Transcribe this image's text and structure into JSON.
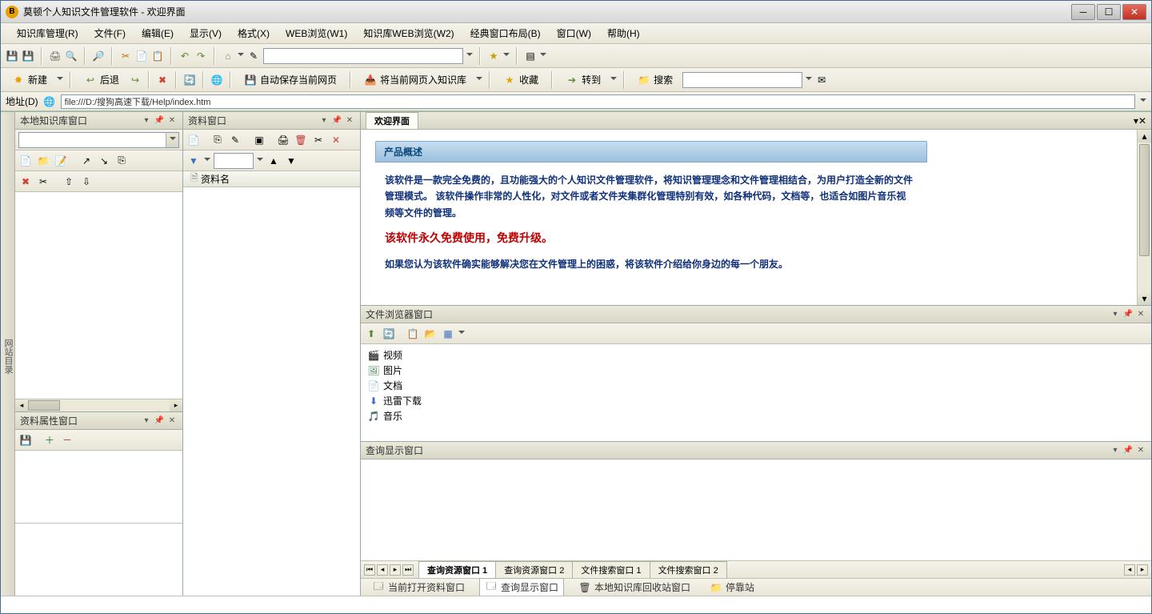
{
  "window": {
    "title": "莫顿个人知识文件管理软件 - 欢迎界面"
  },
  "menu": {
    "items": [
      "知识库管理(R)",
      "文件(F)",
      "编辑(E)",
      "显示(V)",
      "格式(X)",
      "WEB浏览(W1)",
      "知识库WEB浏览(W2)",
      "经典窗口布局(B)",
      "窗口(W)",
      "帮助(H)"
    ]
  },
  "toolbar2": {
    "new": "新建",
    "back": "后退",
    "savepage": "自动保存当前网页",
    "addtokb": "将当前网页入知识库",
    "fav": "收藏",
    "goto": "转到",
    "search": "搜索"
  },
  "address": {
    "label": "地址(D)",
    "value": "file:///D:/搜狗高速下载/Help/index.htm"
  },
  "leftRail": "网站目录",
  "panels": {
    "localkb": "本地知识库窗口",
    "material": "资料窗口",
    "matName": "资料名",
    "matAttr": "资料属性窗口",
    "welcome": "欢迎界面",
    "fileBrowser": "文件浏览器窗口",
    "queryDisplay": "查询显示窗口"
  },
  "overview": {
    "header": "产品概述",
    "p1": "该软件是一款完全免费的，且功能强大的个人知识文件管理软件，将知识管理理念和文件管理相结合，为用户打造全新的文件管理模式。 该软件操作非常的人性化，对文件或者文件夹集群化管理特别有效，如各种代码，文档等，也适合如图片音乐视频等文件的管理。",
    "p2": "该软件永久免费使用，免费升级。",
    "p3": "如果您认为该软件确实能够解决您在文件管理上的困惑，将该软件介绍给你身边的每一个朋友。"
  },
  "files": {
    "items": [
      "视频",
      "图片",
      "文档",
      "迅雷下载",
      "音乐"
    ]
  },
  "bottomTabs": [
    "查询资源窗口 1",
    "查询资源窗口 2",
    "文件搜索窗口 1",
    "文件搜索窗口 2"
  ],
  "statusBar": {
    "cur": "当前打开资料窗口",
    "query": "查询显示窗口",
    "recycle": "本地知识库回收站窗口",
    "park": "停靠站"
  }
}
